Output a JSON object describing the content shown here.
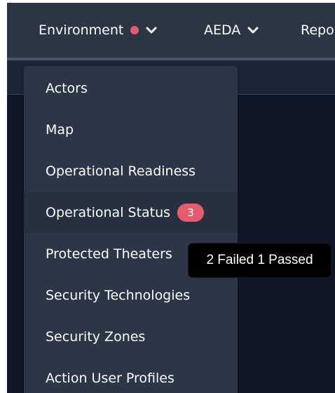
{
  "nav": {
    "items": [
      {
        "label": "Environment",
        "has_alert": true
      },
      {
        "label": "AEDA"
      },
      {
        "label": "Repo"
      }
    ],
    "alert_color": "#e65c6f"
  },
  "menu": {
    "items": [
      {
        "label": "Actors"
      },
      {
        "label": "Map"
      },
      {
        "label": "Operational Readiness"
      },
      {
        "label": "Operational Status",
        "badge": "3",
        "active": true
      },
      {
        "label": "Protected Theaters"
      },
      {
        "label": "Security Technologies"
      },
      {
        "label": "Security Zones"
      },
      {
        "label": "Action User Profiles"
      }
    ],
    "badge_color": "#e65c6f"
  },
  "tooltip": {
    "text": "2 Failed 1 Passed"
  }
}
